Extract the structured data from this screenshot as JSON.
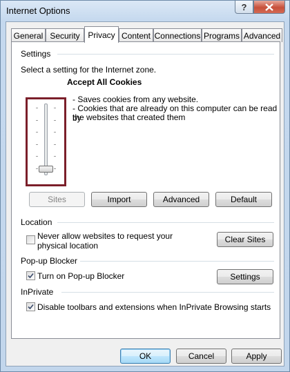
{
  "window": {
    "title": "Internet Options"
  },
  "tabs": [
    "General",
    "Security",
    "Privacy",
    "Content",
    "Connections",
    "Programs",
    "Advanced"
  ],
  "active_tab": "Privacy",
  "settings": {
    "group_label": "Settings",
    "zone_prompt": "Select a setting for the Internet zone.",
    "level_title": "Accept All Cookies",
    "desc_line1": "- Saves cookies from any website.",
    "desc_line2": "- Cookies that are already on this computer can be read by",
    "desc_line3": "the websites that created them",
    "slider_level": 0,
    "slider_levels": 6,
    "buttons": {
      "sites": "Sites",
      "import": "Import",
      "advanced": "Advanced",
      "default": "Default"
    }
  },
  "location": {
    "group_label": "Location",
    "checkbox_line1": "Never allow websites to request your",
    "checkbox_line2": "physical location",
    "checked": false,
    "clear_sites": "Clear Sites"
  },
  "popup": {
    "group_label": "Pop-up Blocker",
    "checkbox_label": "Turn on Pop-up Blocker",
    "checked": true,
    "settings_button": "Settings"
  },
  "inprivate": {
    "group_label": "InPrivate",
    "checkbox_label": "Disable toolbars and extensions when InPrivate Browsing starts",
    "checked": true
  },
  "footer": {
    "ok": "OK",
    "cancel": "Cancel",
    "apply": "Apply"
  }
}
